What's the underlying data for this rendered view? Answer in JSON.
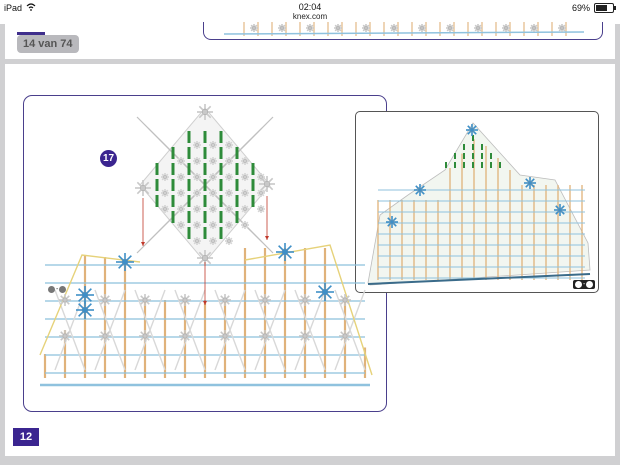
{
  "status_bar": {
    "device": "iPad",
    "time": "02:04",
    "url": "knex.com",
    "battery": "69%",
    "battery_level": 0.69
  },
  "viewer": {
    "page_counter": "14 van 74",
    "page_number": "12"
  },
  "instruction": {
    "step_number": "17",
    "part_ref": "● - ●",
    "preview_ref": "● - ●"
  },
  "colors": {
    "accent": "#3b2590",
    "frame": "#4a3f8c",
    "connector_green": "#2e8b3a",
    "rod_tan": "#e0b27a",
    "rod_blue": "#8fc2de",
    "rod_yellow": "#e6d27a",
    "connector_grey": "#c8c8c8",
    "connector_blue": "#3e8fc7"
  }
}
